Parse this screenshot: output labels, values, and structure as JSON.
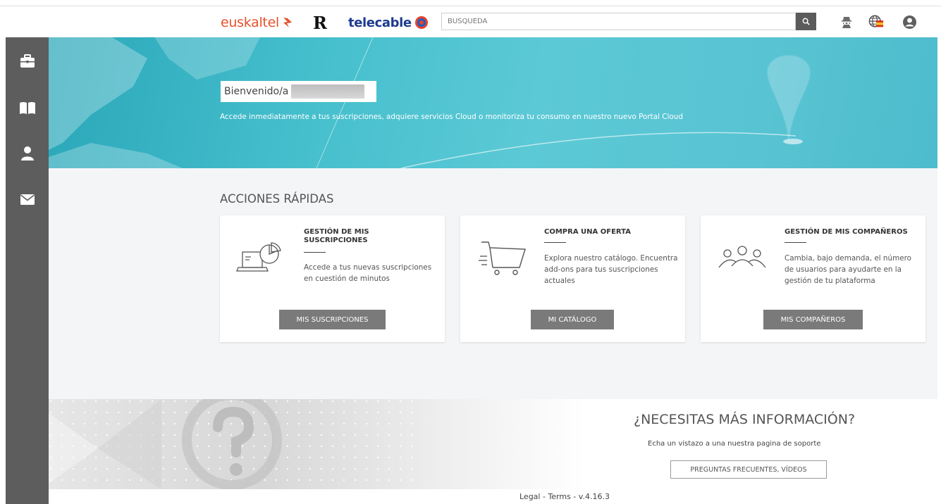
{
  "header": {
    "logos": {
      "euskaltel": "euskaltel",
      "r": "R",
      "telecable": "telecable"
    },
    "search": {
      "placeholder": "BÚSQUEDA"
    },
    "icons": [
      "search-icon",
      "user-secret-icon",
      "globe-language-icon",
      "user-circle-icon"
    ]
  },
  "sidebar": {
    "items": [
      {
        "icon": "briefcase-icon"
      },
      {
        "icon": "book-icon"
      },
      {
        "icon": "user-icon"
      },
      {
        "icon": "envelope-icon"
      }
    ]
  },
  "banner": {
    "welcome": "Bienvenido/a",
    "subtitle": "Accede inmediatamente a tus suscripciones, adquiere servicios Cloud o monitoriza tu consumo en nuestro nuevo Portal Cloud"
  },
  "quick_actions": {
    "title": "ACCIONES RÁPIDAS",
    "cards": [
      {
        "title": "GESTIÓN DE MIS SUSCRIPCIONES",
        "description": "Accede a tus nuevas suscripciones en cuestión de minutos",
        "button": "MIS SUSCRIPCIONES",
        "icon": "laptop-chart-icon"
      },
      {
        "title": "COMPRA UNA OFERTA",
        "description": "Explora nuestro catálogo. Encuentra add-ons para tus suscripciones actuales",
        "button": "MI CATÁLOGO",
        "icon": "shopping-cart-icon"
      },
      {
        "title": "GESTIÓN DE MIS COMPAÑEROS",
        "description": "Cambia, bajo demanda, el número de usuarios para ayudarte en la gestión de tu plataforma",
        "button": "MIS COMPAÑEROS",
        "icon": "people-group-icon"
      }
    ]
  },
  "info": {
    "title": "¿NECESITAS MÁS INFORMACIÓN?",
    "subtitle": "Echa un vistazo a una nuestra pagina de soporte",
    "button": "PREGUNTAS FRECUENTES, VÍDEOS"
  },
  "footer": {
    "text": "Legal - Terms - v.4.16.3"
  },
  "colors": {
    "sidebar": "#5d5d5d",
    "banner": "#4fc1d0",
    "button": "#7a7a7a",
    "euskaltel": "#e5512b",
    "telecable": "#1d3b8f"
  }
}
